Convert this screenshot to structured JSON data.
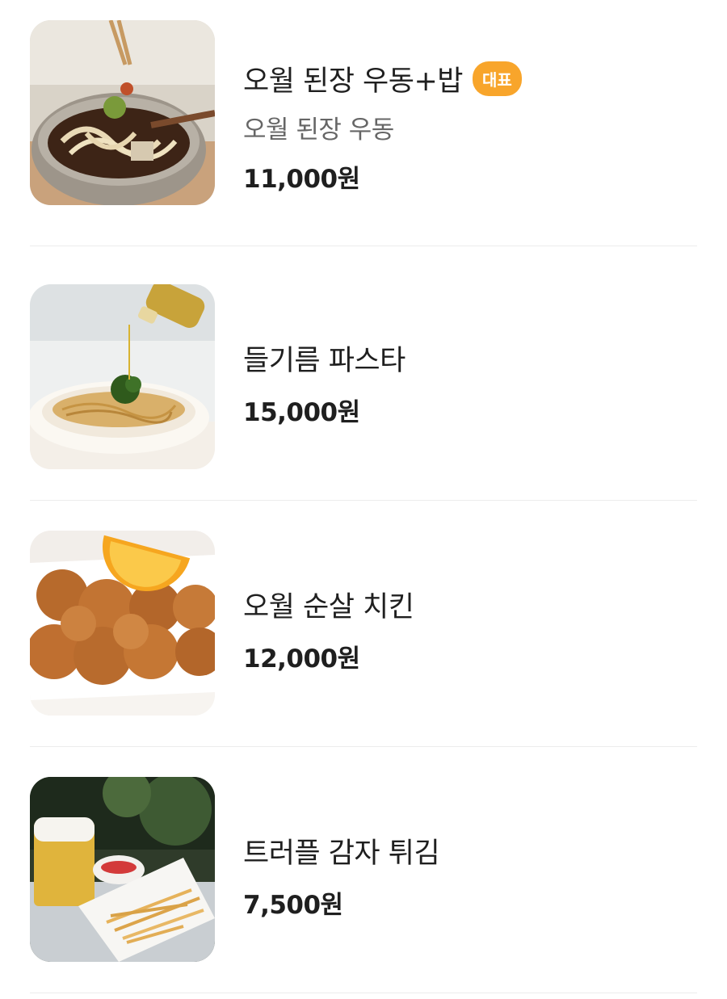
{
  "menu": {
    "items": [
      {
        "name": "오월 된장 우동+밥",
        "badge": "대표",
        "description": "오월 된장 우동",
        "price": "11,000원",
        "image_icon": "udon-bowl-image"
      },
      {
        "name": "들기름 파스타",
        "price": "15,000원",
        "image_icon": "pasta-plate-image"
      },
      {
        "name": "오월 순살 치킨",
        "price": "12,000원",
        "image_icon": "fried-chicken-image"
      },
      {
        "name": "트러플 감자 튀김",
        "price": "7,500원",
        "image_icon": "fries-beer-image"
      }
    ],
    "colors": {
      "badge_bg": "#f8a52b",
      "text_primary": "#1f1f1f",
      "text_secondary": "#666666",
      "divider": "#ececec"
    }
  }
}
